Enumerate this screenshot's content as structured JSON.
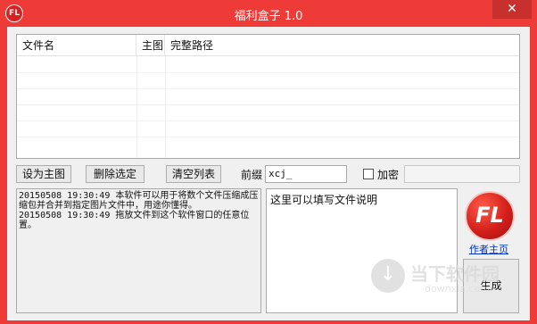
{
  "window": {
    "title": "福利盒子 1.0",
    "app_icon_text": "FL",
    "close_symbol": "✕",
    "frame_color": "#ef3b38"
  },
  "file_list": {
    "columns": [
      "文件名",
      "主图",
      "完整路径"
    ]
  },
  "toolbar": {
    "set_main_label": "设为主图",
    "delete_label": "删除选定",
    "clear_label": "清空列表",
    "prefix_label": "前缀",
    "prefix_value": "xcj_",
    "encrypt_label": "加密",
    "encrypt_checked": false,
    "encrypt_value": ""
  },
  "log": {
    "lines": [
      "20150508 19:30:49  本软件可以用于将数个文件压缩成压缩包并合并到指定图片文件中，用途你懂得。",
      "20150508 19:30:49  拖放文件到这个软件窗口的任意位置。"
    ]
  },
  "description": {
    "text": "这里可以填写文件说明"
  },
  "side": {
    "logo_text": "FL",
    "author_link": "作者主页",
    "generate_label": "生成"
  },
  "watermark": {
    "icon": "download-arrow-icon",
    "text": "当下软件园",
    "url": "downxia.com"
  }
}
